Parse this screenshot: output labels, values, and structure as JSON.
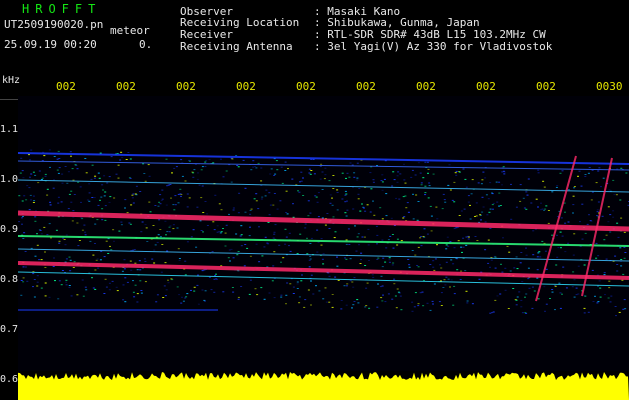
{
  "header": {
    "app_title": "HROFFT",
    "file_name": "UT2509190020.pn",
    "mode_tag": "meteor",
    "date_time": "25.09.19 00:20",
    "level": "0.",
    "meta": [
      {
        "label": "Observer",
        "value": ": Masaki Kano"
      },
      {
        "label": "Receiving Location",
        "value": ": Shibukawa, Gunma, Japan"
      },
      {
        "label": "Receiver",
        "value": ": RTL-SDR SDR# 43dB L15 103.2MHz CW"
      },
      {
        "label": "Receiving Antenna",
        "value": ": 3el Yagi(V) Az 330 for Vladivostok"
      }
    ]
  },
  "axes": {
    "unit": "kHz",
    "y_ticks": [
      "1.1",
      "1.0",
      "0.9",
      "0.8",
      "0.7",
      "0.6"
    ],
    "x_ticks": [
      "002",
      "002",
      "002",
      "002",
      "002",
      "002",
      "002",
      "002",
      "002",
      "0030"
    ]
  },
  "colors": {
    "background": "#000000",
    "label_text": "#e8e8e8",
    "title_green": "#14e614",
    "tick_yellow": "#e6e600",
    "echo_band": "#ff2a6a",
    "noise_blue": "#1a3cff",
    "amplitude_fill": "#ffff00"
  }
}
